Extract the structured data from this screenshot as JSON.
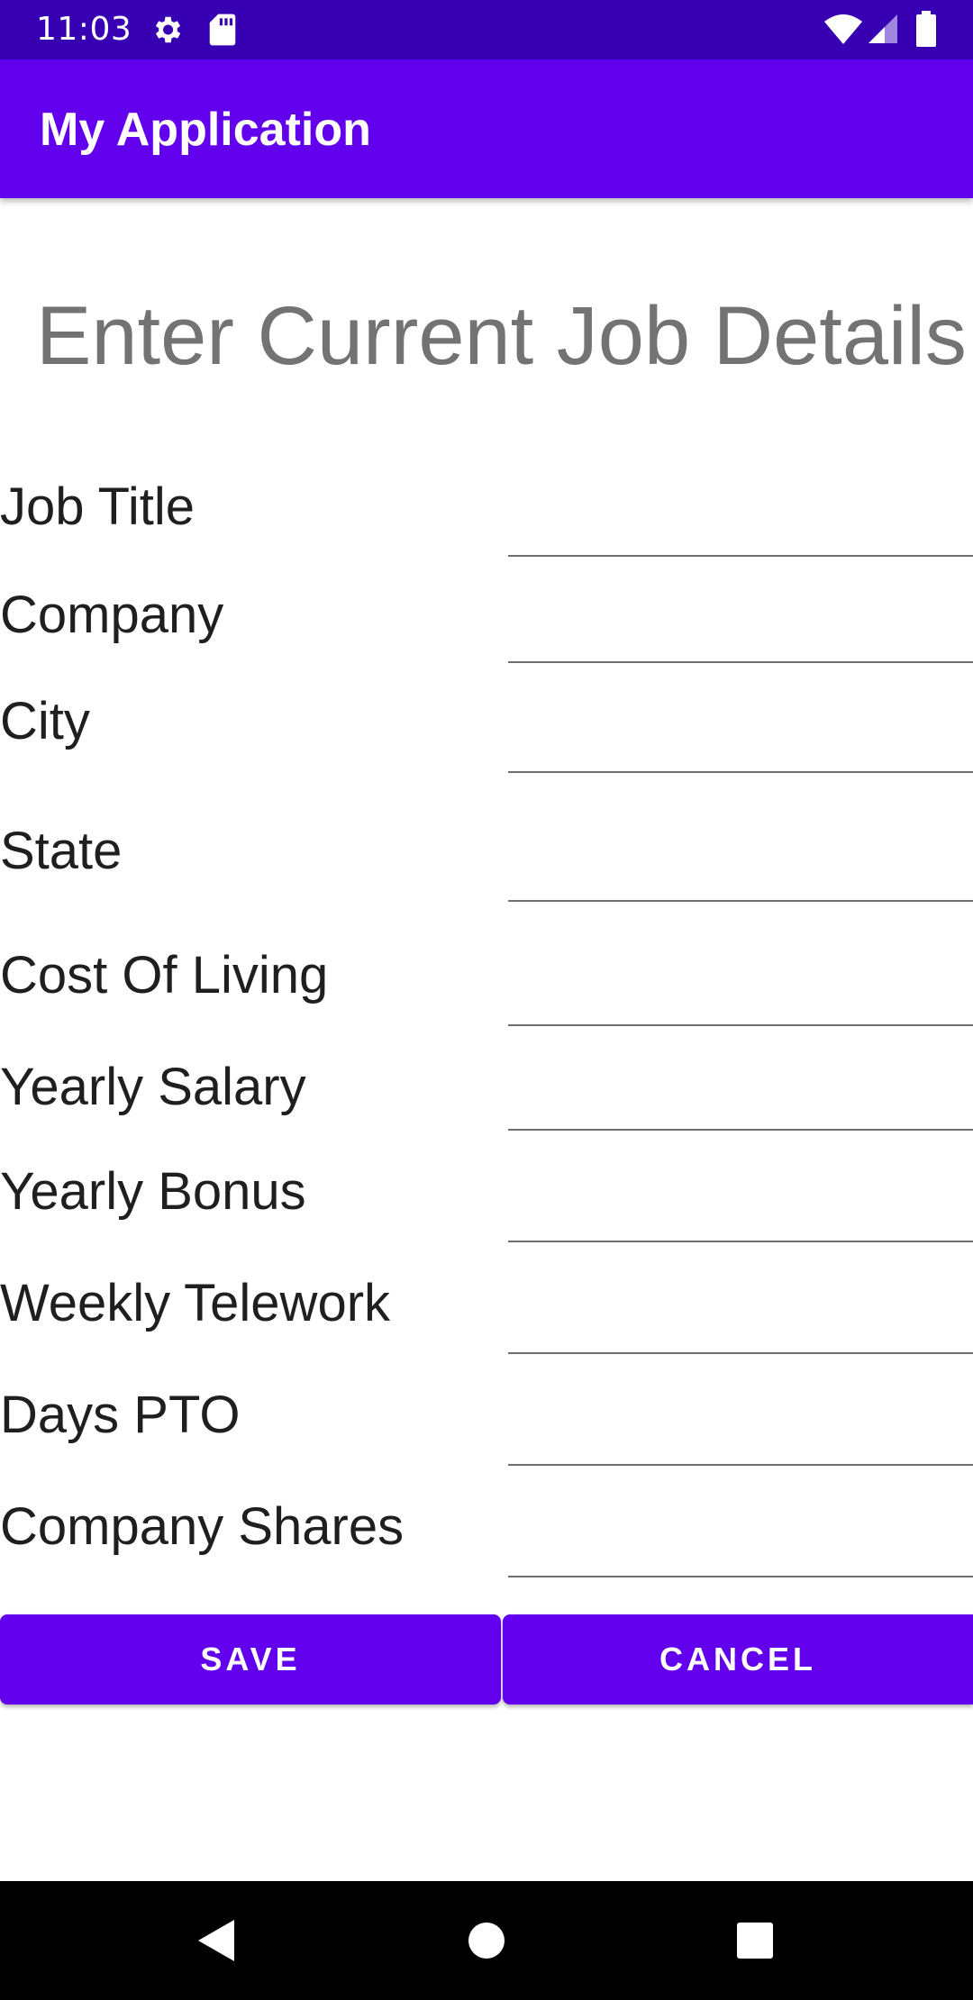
{
  "status_bar": {
    "time": "11:03",
    "icons": [
      "gear-icon",
      "sd-card-icon",
      "wifi-icon",
      "signal-icon",
      "battery-icon"
    ]
  },
  "app_bar": {
    "title": "My Application",
    "color": "#6200EE"
  },
  "heading": "Enter Current Job Details",
  "form": {
    "fields": [
      {
        "label": "Job Title",
        "value": ""
      },
      {
        "label": "Company",
        "value": ""
      },
      {
        "label": "City",
        "value": ""
      },
      {
        "label": "State",
        "value": ""
      },
      {
        "label": "Cost Of Living",
        "value": ""
      },
      {
        "label": "Yearly Salary",
        "value": ""
      },
      {
        "label": "Yearly Bonus",
        "value": ""
      },
      {
        "label": "Weekly Telework",
        "value": ""
      },
      {
        "label": "Days PTO",
        "value": ""
      },
      {
        "label": "Company Shares",
        "value": ""
      }
    ]
  },
  "buttons": {
    "save_label": "SAVE",
    "cancel_label": "CANCEL"
  },
  "nav_bar": {
    "icons": [
      "back-icon",
      "home-icon",
      "recents-icon"
    ]
  },
  "colors": {
    "status_bar": "#3700B3",
    "primary": "#6200EE",
    "heading_text": "#737373"
  }
}
